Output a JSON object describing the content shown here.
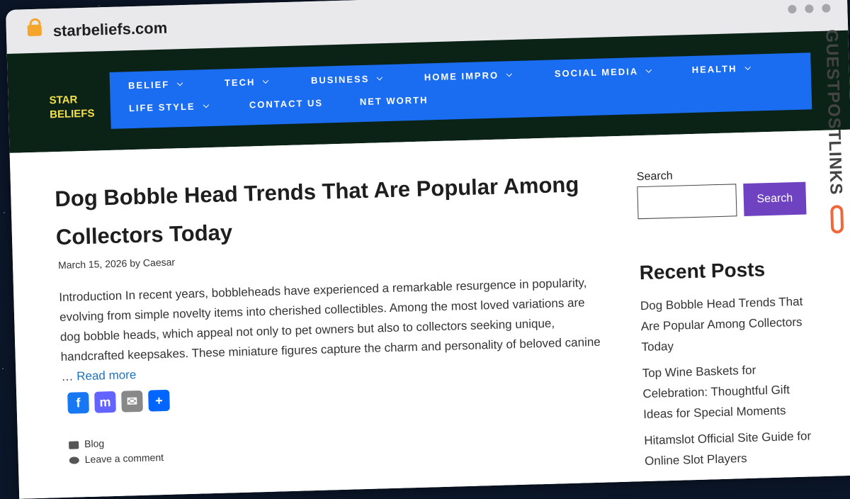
{
  "browser": {
    "url": "starbeliefs.com"
  },
  "site": {
    "logo_line1": "Star",
    "logo_line2": "Beliefs"
  },
  "nav": {
    "items": [
      {
        "label": "BELIEF"
      },
      {
        "label": "TECH"
      },
      {
        "label": "BUSINESS"
      },
      {
        "label": "HOME IMPRO"
      },
      {
        "label": "SOCIAL MEDIA"
      },
      {
        "label": "HEALTH"
      },
      {
        "label": "LIFE STYLE"
      },
      {
        "label": "CONTACT US"
      },
      {
        "label": "NET WORTH"
      }
    ]
  },
  "post": {
    "title": "Dog Bobble Head Trends That Are Popular Among Collectors Today",
    "date": "March 15, 2026",
    "by": "by",
    "author": "Caesar",
    "excerpt": "Introduction  In recent years, bobbleheads have experienced a remarkable resurgence in popularity, evolving from simple novelty items into cherished collectibles. Among the most loved variations are dog bobble heads, which appeal not only to pet owners but also to collectors seeking unique, handcrafted keepsakes. These miniature figures capture the charm and personality of beloved canine …",
    "read_more": "Read more",
    "category": "Blog",
    "comment_link": "Leave a comment"
  },
  "share": {
    "facebook_glyph": "f",
    "mastodon_glyph": "m",
    "email_glyph": "✉",
    "share_glyph": "+",
    "colors": {
      "facebook": "#1877f2",
      "mastodon": "#6364ff",
      "email": "#888888",
      "share": "#0166ff"
    }
  },
  "sidebar": {
    "search_label": "Search",
    "search_value": "",
    "search_button": "Search",
    "recent_title": "Recent Posts",
    "recent": [
      {
        "title": "Dog Bobble Head Trends That Are Popular Among Collectors Today"
      },
      {
        "title": "Top Wine Baskets for Celebration: Thoughtful Gift Ideas for Special Moments"
      },
      {
        "title": "Hitamslot Official Site Guide for Online Slot Players"
      }
    ]
  },
  "watermark": {
    "text": "GUESTPOSTLINKS"
  },
  "colors": {
    "header_bg": "#0b2216",
    "nav_bg": "#1a6cf0",
    "logo": "#f4e04d",
    "search_button": "#6f42c1",
    "link": "#1e73be"
  }
}
